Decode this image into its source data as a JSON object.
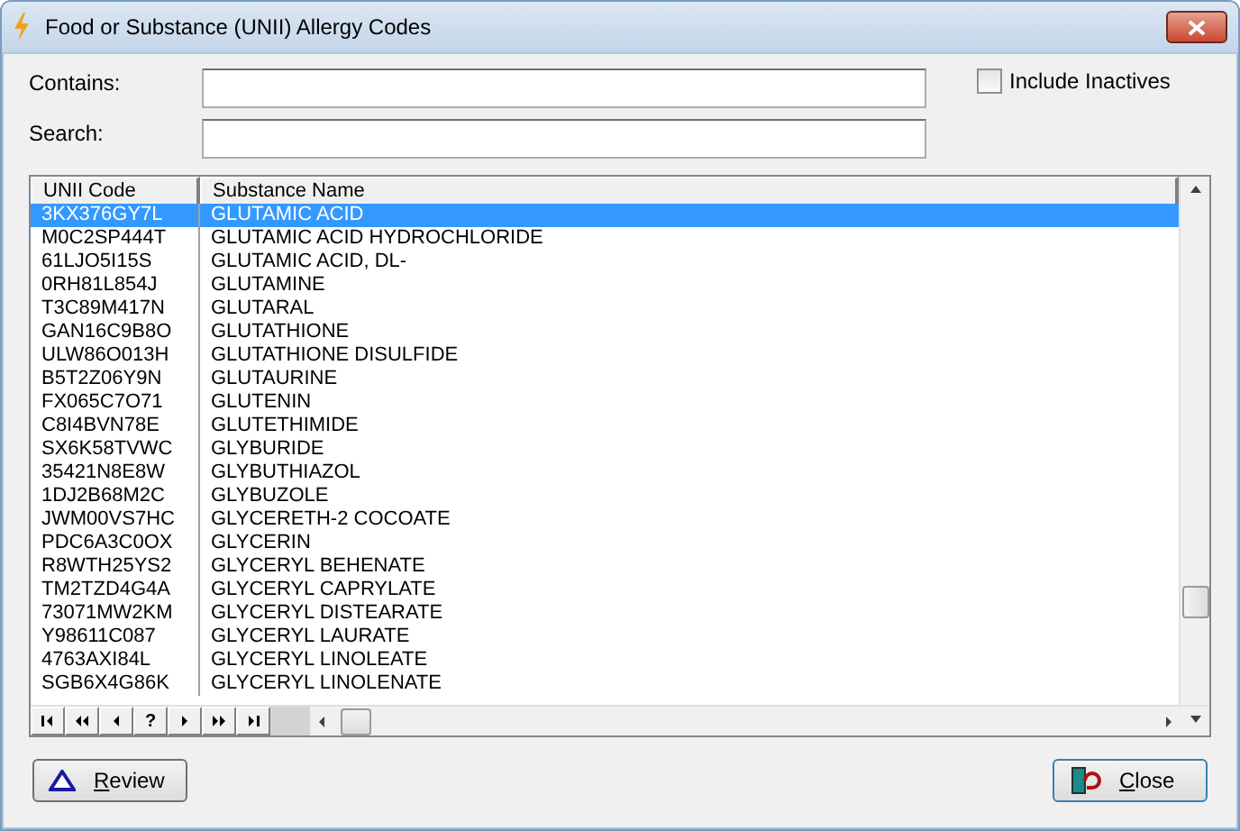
{
  "window": {
    "title": "Food or Substance (UNII) Allergy Codes"
  },
  "filters": {
    "contains": {
      "label": "Contains:"
    },
    "search": {
      "label": "Search:"
    },
    "include_inactives": {
      "label": "Include Inactives",
      "checked": false
    }
  },
  "table": {
    "columns": [
      "UNII Code",
      "Substance Name"
    ],
    "rows": [
      {
        "code": "3KX376GY7L",
        "name": "GLUTAMIC ACID",
        "selected": true
      },
      {
        "code": "M0C2SP444T",
        "name": "GLUTAMIC ACID HYDROCHLORIDE",
        "selected": false
      },
      {
        "code": "61LJO5I15S",
        "name": "GLUTAMIC ACID, DL-",
        "selected": false
      },
      {
        "code": "0RH81L854J",
        "name": "GLUTAMINE",
        "selected": false
      },
      {
        "code": "T3C89M417N",
        "name": "GLUTARAL",
        "selected": false
      },
      {
        "code": "GAN16C9B8O",
        "name": "GLUTATHIONE",
        "selected": false
      },
      {
        "code": "ULW86O013H",
        "name": "GLUTATHIONE DISULFIDE",
        "selected": false
      },
      {
        "code": "B5T2Z06Y9N",
        "name": "GLUTAURINE",
        "selected": false
      },
      {
        "code": "FX065C7O71",
        "name": "GLUTENIN",
        "selected": false
      },
      {
        "code": "C8I4BVN78E",
        "name": "GLUTETHIMIDE",
        "selected": false
      },
      {
        "code": "SX6K58TVWC",
        "name": "GLYBURIDE",
        "selected": false
      },
      {
        "code": "35421N8E8W",
        "name": "GLYBUTHIAZOL",
        "selected": false
      },
      {
        "code": "1DJ2B68M2C",
        "name": "GLYBUZOLE",
        "selected": false
      },
      {
        "code": "JWM00VS7HC",
        "name": "GLYCERETH-2 COCOATE",
        "selected": false
      },
      {
        "code": "PDC6A3C0OX",
        "name": "GLYCERIN",
        "selected": false
      },
      {
        "code": "R8WTH25YS2",
        "name": "GLYCERYL BEHENATE",
        "selected": false
      },
      {
        "code": "TM2TZD4G4A",
        "name": "GLYCERYL CAPRYLATE",
        "selected": false
      },
      {
        "code": "73071MW2KM",
        "name": "GLYCERYL DISTEARATE",
        "selected": false
      },
      {
        "code": "Y98611C087",
        "name": "GLYCERYL LAURATE",
        "selected": false
      },
      {
        "code": "4763AXI84L",
        "name": "GLYCERYL LINOLEATE",
        "selected": false
      },
      {
        "code": "SGB6X4G86K",
        "name": "GLYCERYL LINOLENATE",
        "selected": false
      }
    ]
  },
  "navigator": [
    {
      "kind": "first"
    },
    {
      "kind": "prior-page"
    },
    {
      "kind": "prior"
    },
    {
      "kind": "help",
      "label": "?"
    },
    {
      "kind": "next"
    },
    {
      "kind": "next-page"
    },
    {
      "kind": "last"
    }
  ],
  "buttons": {
    "review": "Review",
    "close": "Close"
  }
}
